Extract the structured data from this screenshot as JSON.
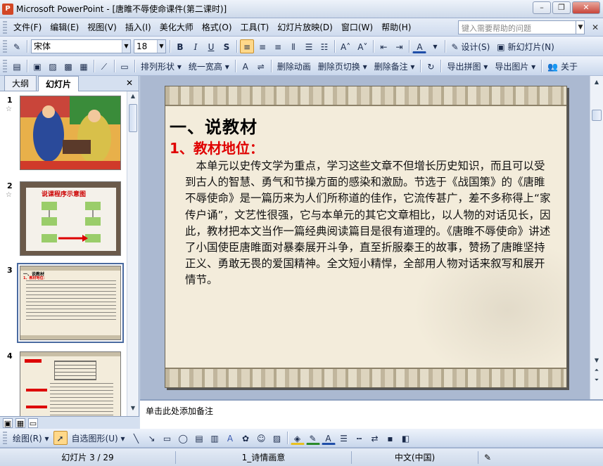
{
  "window": {
    "title": "Microsoft PowerPoint - [唐睢不辱使命课件(第二课时)]",
    "app_icon": "P"
  },
  "menu": {
    "items": [
      "文件(F)",
      "编辑(E)",
      "视图(V)",
      "插入(I)",
      "美化大师",
      "格式(O)",
      "工具(T)",
      "幻灯片放映(D)",
      "窗口(W)",
      "帮助(H)"
    ],
    "help_placeholder": "键入需要帮助的问题"
  },
  "toolbar1": {
    "font_name": "宋体",
    "font_size": "18",
    "bold": "B",
    "italic": "I",
    "underline": "U",
    "shadow": "S",
    "design_label": "设计(S)",
    "new_slide_label": "新幻灯片(N)"
  },
  "toolbar2": {
    "arrange": "排列形状",
    "uniform_width": "统一宽高",
    "remove_animation": "删除动画",
    "remove_transition": "删除页切换",
    "remove_notes": "删除备注",
    "export_collage": "导出拼图",
    "export_images": "导出图片",
    "about": "关于"
  },
  "panel": {
    "tab_outline": "大纲",
    "tab_slides": "幻灯片",
    "thumbs": [
      {
        "num": "1",
        "star": "☆"
      },
      {
        "num": "2",
        "star": "☆"
      },
      {
        "num": "3",
        "star": ""
      },
      {
        "num": "4",
        "star": ""
      }
    ],
    "thumb2_title": "说课程序示意图",
    "thumb3_heading": "一、说教材",
    "thumb3_sub": "1、教材地位："
  },
  "slide": {
    "heading": "一、说教材",
    "subheading": "1、教材地位：",
    "body": "本单元以史传文学为重点，学习这些文章不但增长历史知识，而且可以受到古人的智慧、勇气和节操方面的感染和激励。节选于《战国策》的《唐睢不辱使命》是一篇历来为人们所称道的佳作，它流传甚广，差不多称得上“家传户诵”，文艺性很强，它与本单元的其它文章相比，以人物的对话见长，因此，教材把本文当作一篇经典阅读篇目是很有道理的。《唐睢不辱使命》讲述了小国使臣唐睢面对暴秦展开斗争，直至折服秦王的故事，赞扬了唐睢坚持正义、勇敢无畏的爱国精神。全文短小精悍，全部用人物对话来叙写和展开情节。"
  },
  "notes": {
    "placeholder": "单击此处添加备注"
  },
  "drawing": {
    "draw_label": "绘图(R)",
    "autoshapes_label": "自选图形(U)"
  },
  "status": {
    "slide_pos": "幻灯片 3 / 29",
    "template": "1_诗情画意",
    "language": "中文(中国)"
  }
}
